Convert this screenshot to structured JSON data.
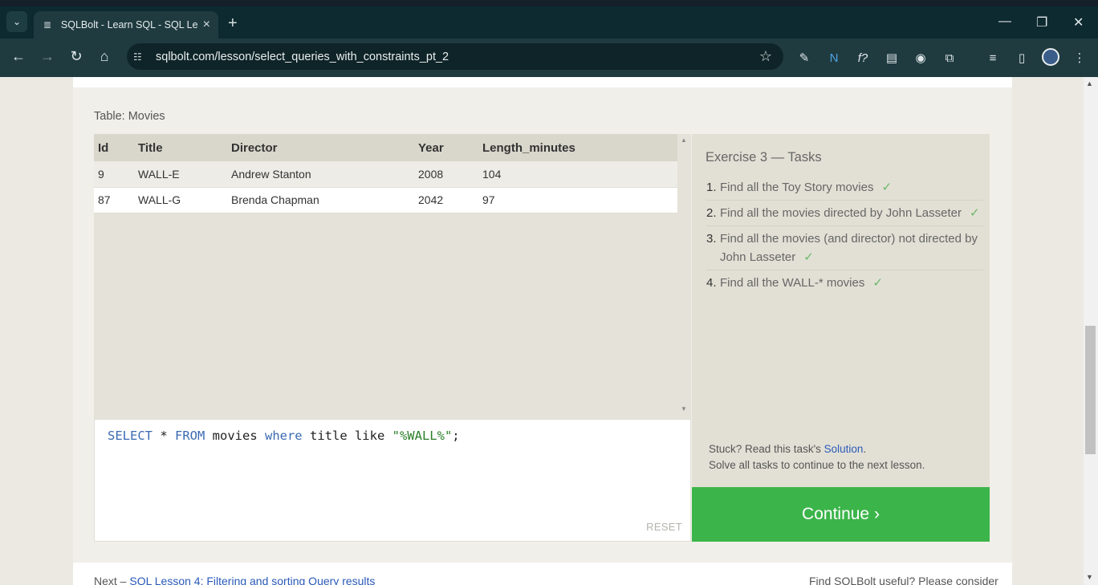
{
  "browser": {
    "tab_title": "SQLBolt - Learn SQL - SQL Less",
    "url": "sqlbolt.com/lesson/select_queries_with_constraints_pt_2"
  },
  "lesson": {
    "table_caption": "Table: Movies",
    "columns": [
      "Id",
      "Title",
      "Director",
      "Year",
      "Length_minutes"
    ],
    "rows": [
      [
        "9",
        "WALL-E",
        "Andrew Stanton",
        "2008",
        "104"
      ],
      [
        "87",
        "WALL-G",
        "Brenda Chapman",
        "2042",
        "97"
      ]
    ],
    "query": {
      "select": "SELECT",
      "star": " * ",
      "from": "FROM",
      "table": " movies ",
      "where": "where",
      "cond": " title like ",
      "pattern": "\"%WALL%\"",
      "end": ";"
    },
    "reset_label": "RESET"
  },
  "tasks": {
    "title": "Exercise 3 — Tasks",
    "items": [
      {
        "num": "1.",
        "text": "Find all the Toy Story movies",
        "check": "✓"
      },
      {
        "num": "2.",
        "text": "Find all the movies directed by John Lasseter",
        "check": "✓"
      },
      {
        "num": "3.",
        "text": "Find all the movies (and director) not directed by John Lasseter",
        "check": "✓"
      },
      {
        "num": "4.",
        "text": "Find all the WALL-* movies",
        "check": "✓"
      }
    ],
    "stuck_prefix": "Stuck? Read this task's ",
    "solution_link": "Solution",
    "stuck_suffix": ".",
    "solve_all": "Solve all tasks to continue to the next lesson."
  },
  "continue_label": "Continue ›",
  "footer": {
    "next_prefix": "Next – ",
    "next_link": "SQL Lesson 4: Filtering and sorting Query results",
    "find_text": "Find SQLBolt useful? Please consider"
  }
}
